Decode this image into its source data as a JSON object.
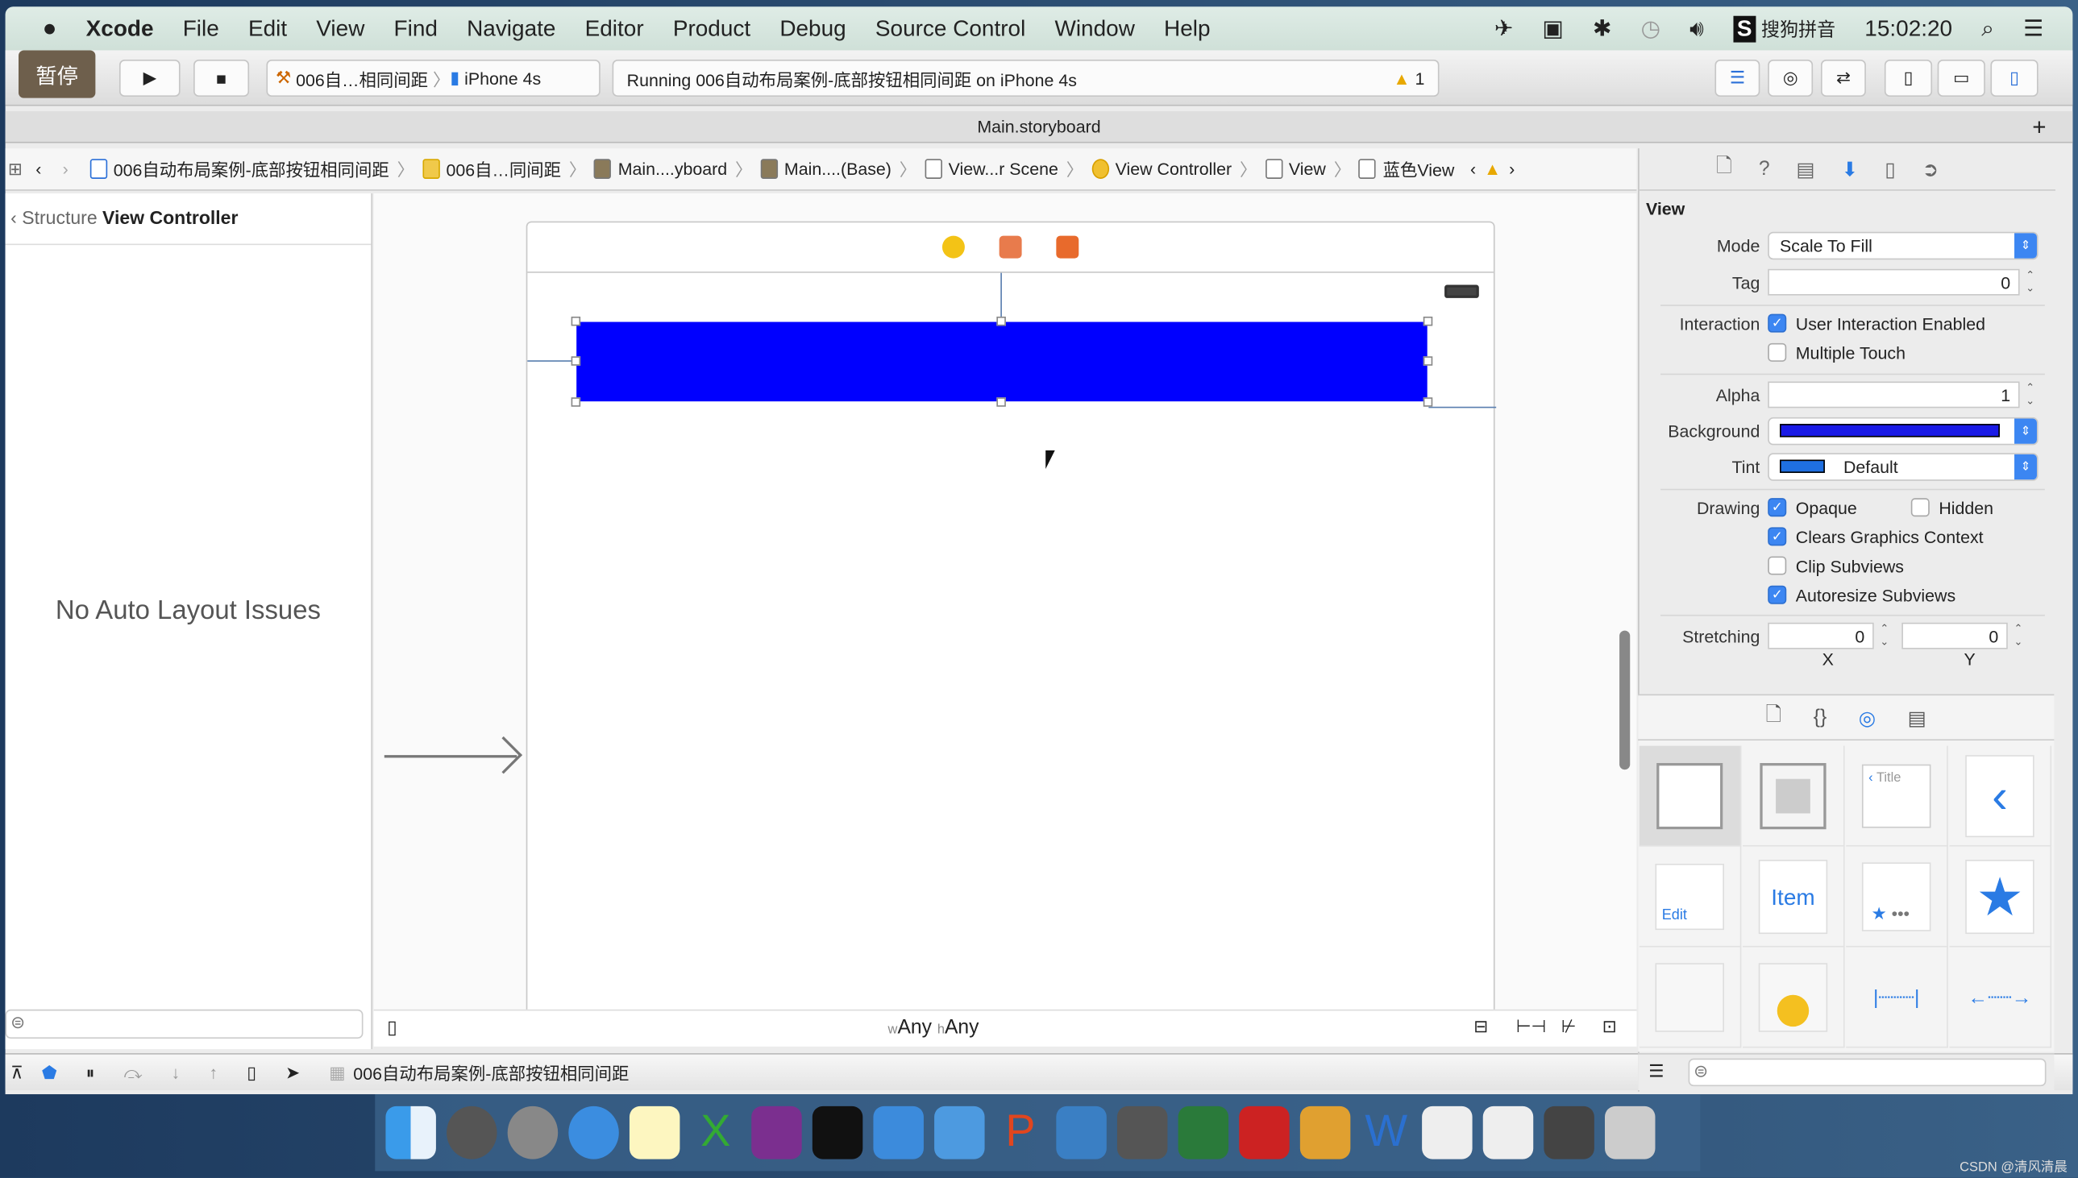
{
  "menubar": {
    "app": "Xcode",
    "items": [
      "File",
      "Edit",
      "View",
      "Find",
      "Navigate",
      "Editor",
      "Product",
      "Debug",
      "Source Control",
      "Window",
      "Help"
    ],
    "input_method": "搜狗拼音",
    "clock": "15:02:20"
  },
  "toolbar": {
    "pause_label": "暂停",
    "scheme": "006自…相同间距",
    "device": "iPhone 4s",
    "status": "Running 006自动布局案例-底部按钮相同间距 on iPhone 4s",
    "warning_count": "1"
  },
  "tab": {
    "title": "Main.storyboard"
  },
  "jumpbar": [
    "006自动布局案例-底部按钮相同间距",
    "006自…同间距",
    "Main....yboard",
    "Main....(Base)",
    "View...r Scene",
    "View Controller",
    "View",
    "蓝色View"
  ],
  "navigator": {
    "back_label": "Structure",
    "title": "View Controller",
    "message": "No Auto Layout Issues"
  },
  "canvas": {
    "size_class_w": "w",
    "size_class_w_value": "Any",
    "size_class_h": "h",
    "size_class_h_value": "Any",
    "view_color": "#0000ff"
  },
  "debugbar": {
    "target": "006自动布局案例-底部按钮相同间距"
  },
  "inspector": {
    "section": "View",
    "mode": {
      "label": "Mode",
      "value": "Scale To Fill"
    },
    "tag": {
      "label": "Tag",
      "value": "0"
    },
    "interaction": {
      "label": "Interaction",
      "options": [
        {
          "label": "User Interaction Enabled",
          "checked": true
        },
        {
          "label": "Multiple Touch",
          "checked": false
        }
      ]
    },
    "alpha": {
      "label": "Alpha",
      "value": "1"
    },
    "background": {
      "label": "Background",
      "color": "#1a1ae6"
    },
    "tint": {
      "label": "Tint",
      "value": "Default",
      "color": "#1f6fe0"
    },
    "drawing": {
      "label": "Drawing",
      "opaque": {
        "label": "Opaque",
        "checked": true
      },
      "hidden": {
        "label": "Hidden",
        "checked": false
      },
      "clears": {
        "label": "Clears Graphics Context",
        "checked": true
      },
      "clip": {
        "label": "Clip Subviews",
        "checked": false
      },
      "autoresize": {
        "label": "Autoresize Subviews",
        "checked": true
      }
    },
    "stretching": {
      "label": "Stretching",
      "x": "0",
      "y": "0",
      "x_label": "X",
      "y_label": "Y"
    }
  },
  "library": {
    "cells": [
      "",
      "",
      "Title",
      "",
      "Edit",
      "Item",
      "",
      "",
      "",
      "",
      "",
      ""
    ]
  },
  "watermark": "CSDN @清风清晨"
}
